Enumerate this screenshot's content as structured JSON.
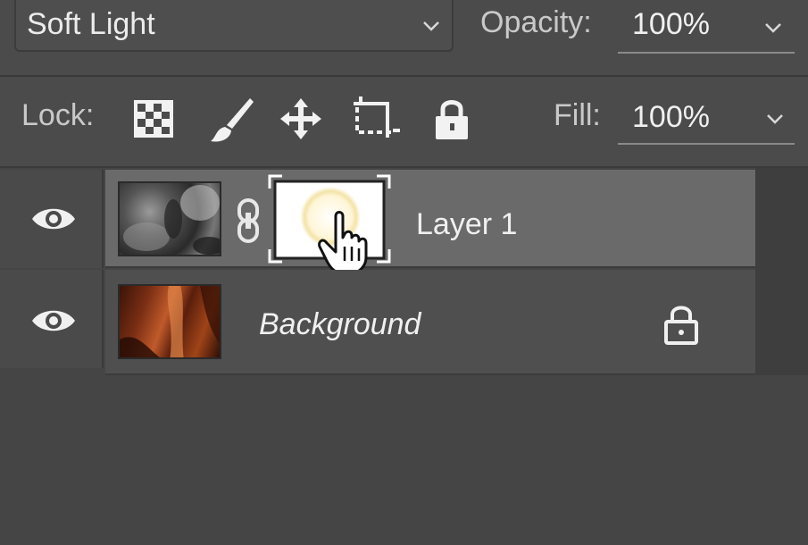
{
  "blend_mode": {
    "value": "Soft Light",
    "icon": "chevron-down-icon"
  },
  "opacity": {
    "label": "Opacity:",
    "value": "100%",
    "icon": "chevron-down-icon"
  },
  "lock": {
    "label": "Lock:",
    "buttons": [
      {
        "name": "lock-transparent-pixels",
        "icon": "checkerboard-icon"
      },
      {
        "name": "lock-image-pixels",
        "icon": "brush-icon"
      },
      {
        "name": "lock-position",
        "icon": "move-arrows-icon"
      },
      {
        "name": "lock-artboard",
        "icon": "artboard-icon"
      },
      {
        "name": "lock-all",
        "icon": "padlock-icon"
      }
    ]
  },
  "fill": {
    "label": "Fill:",
    "value": "100%",
    "icon": "chevron-down-icon"
  },
  "layers": [
    {
      "name": "Layer 1",
      "visible": true,
      "selected": true,
      "has_mask": true,
      "linked": true
    },
    {
      "name": "Background",
      "visible": true,
      "selected": false,
      "locked": true
    }
  ],
  "colors": {
    "panel": "#4b4b4b",
    "selected_row": "#6a6a6a",
    "row": "#4f4f4f",
    "text": "#f0f0f0"
  }
}
